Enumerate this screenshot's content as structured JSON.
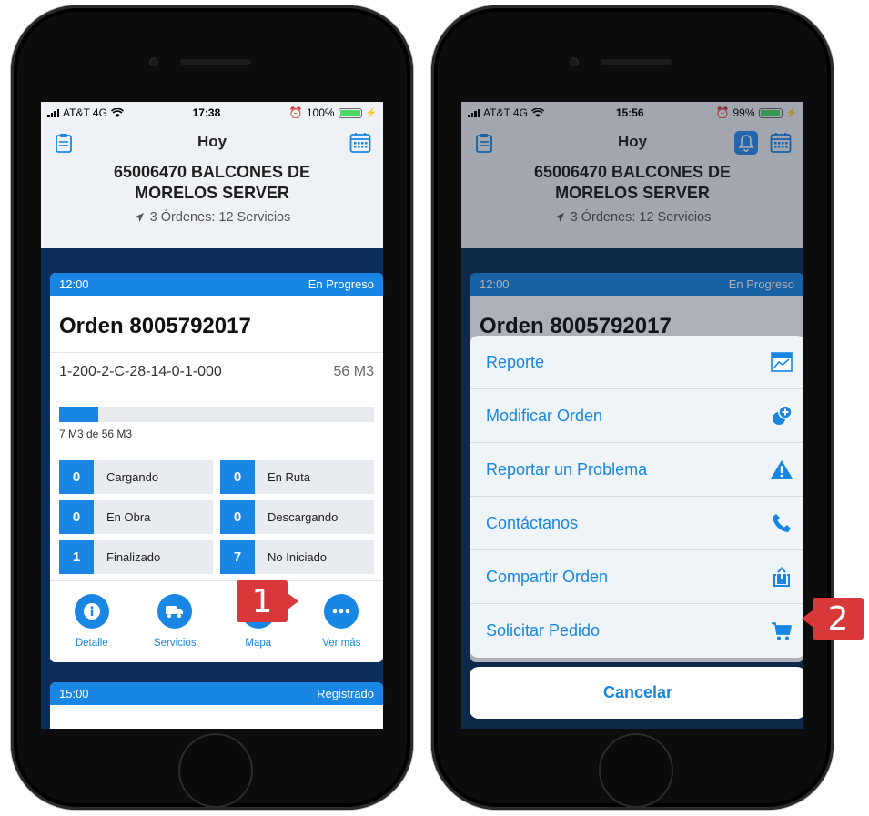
{
  "colors": {
    "accent": "#1a86e4",
    "callout": "#d9383a",
    "dark_bg": "#0b2e5a"
  },
  "phone_left": {
    "status": {
      "carrier": "AT&T 4G",
      "time": "17:38",
      "battery": "100%",
      "battery_level": 1.0
    },
    "nav": {
      "title": "Hoy"
    },
    "site": {
      "name": "65006470 BALCONES DE MORELOS SERVER",
      "summary": "3 Órdenes: 12 Servicios"
    },
    "order": {
      "time": "12:00",
      "status": "En Progreso",
      "title": "Orden 8005792017",
      "route": "1-200-2-C-28-14-0-1-000",
      "volume": "56 M3",
      "progress_text": "7 M3 de 56 M3",
      "progress_fraction": 0.125,
      "states": [
        {
          "count": "0",
          "label": "Cargando"
        },
        {
          "count": "0",
          "label": "En Ruta"
        },
        {
          "count": "0",
          "label": "En Obra"
        },
        {
          "count": "0",
          "label": "Descargando"
        },
        {
          "count": "1",
          "label": "Finalizado"
        },
        {
          "count": "7",
          "label": "No Iniciado"
        }
      ],
      "actions": [
        {
          "label": "Detalle",
          "icon": "info-icon"
        },
        {
          "label": "Servicios",
          "icon": "truck-icon"
        },
        {
          "label": "Mapa",
          "icon": "map-icon"
        },
        {
          "label": "Ver más",
          "icon": "more-icon"
        }
      ]
    },
    "next_order": {
      "time": "15:00",
      "status": "Registrado"
    }
  },
  "phone_right": {
    "status": {
      "carrier": "AT&T 4G",
      "time": "15:56",
      "battery": "99%",
      "battery_level": 0.99
    },
    "nav": {
      "title": "Hoy"
    },
    "site": {
      "name": "65006470 BALCONES DE MORELOS SERVER",
      "summary": "3 Órdenes: 12 Servicios"
    },
    "order": {
      "time": "12:00",
      "status": "En Progreso",
      "title": "Orden 8005792017"
    },
    "sheet": {
      "items": [
        {
          "label": "Reporte",
          "icon": "report-icon"
        },
        {
          "label": "Modificar Orden",
          "icon": "modify-order-icon"
        },
        {
          "label": "Reportar un Problema",
          "icon": "warning-icon"
        },
        {
          "label": "Contáctanos",
          "icon": "phone-icon"
        },
        {
          "label": "Compartir Orden",
          "icon": "share-icon"
        },
        {
          "label": "Solicitar Pedido",
          "icon": "cart-icon"
        }
      ],
      "cancel": "Cancelar"
    }
  },
  "callouts": {
    "step1": "1",
    "step2": "2"
  }
}
